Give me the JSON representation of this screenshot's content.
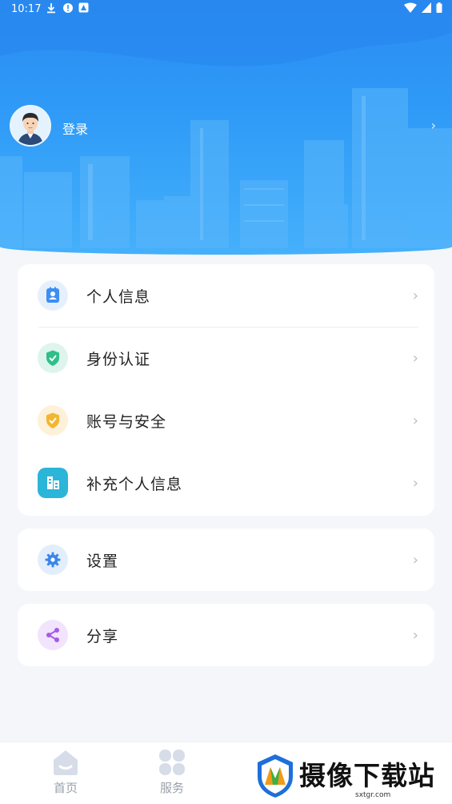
{
  "status_bar": {
    "time": "10:17"
  },
  "header": {
    "login_label": "登录",
    "chevron": "›"
  },
  "menu_group1": [
    {
      "label": "个人信息",
      "icon": "contact-card-icon",
      "color": "#3d8ff3"
    },
    {
      "label": "身份认证",
      "icon": "shield-check-icon",
      "color": "#2fbf8a"
    },
    {
      "label": "账号与安全",
      "icon": "shield-check-icon",
      "color": "#f4b532"
    },
    {
      "label": "补充个人信息",
      "icon": "building-icon",
      "color": "#2bb5d8"
    }
  ],
  "menu_group2": [
    {
      "label": "设置",
      "icon": "gear-icon",
      "color": "#3b86e8"
    }
  ],
  "menu_group3": [
    {
      "label": "分享",
      "icon": "share-icon",
      "color": "#a45be8"
    }
  ],
  "chevron": "›",
  "bottom_nav": [
    {
      "label": "首页",
      "icon": "home-icon"
    },
    {
      "label": "服务",
      "icon": "grid-icon"
    }
  ],
  "watermark": {
    "text": "摄像下载站",
    "url": "sxtgr.com"
  }
}
